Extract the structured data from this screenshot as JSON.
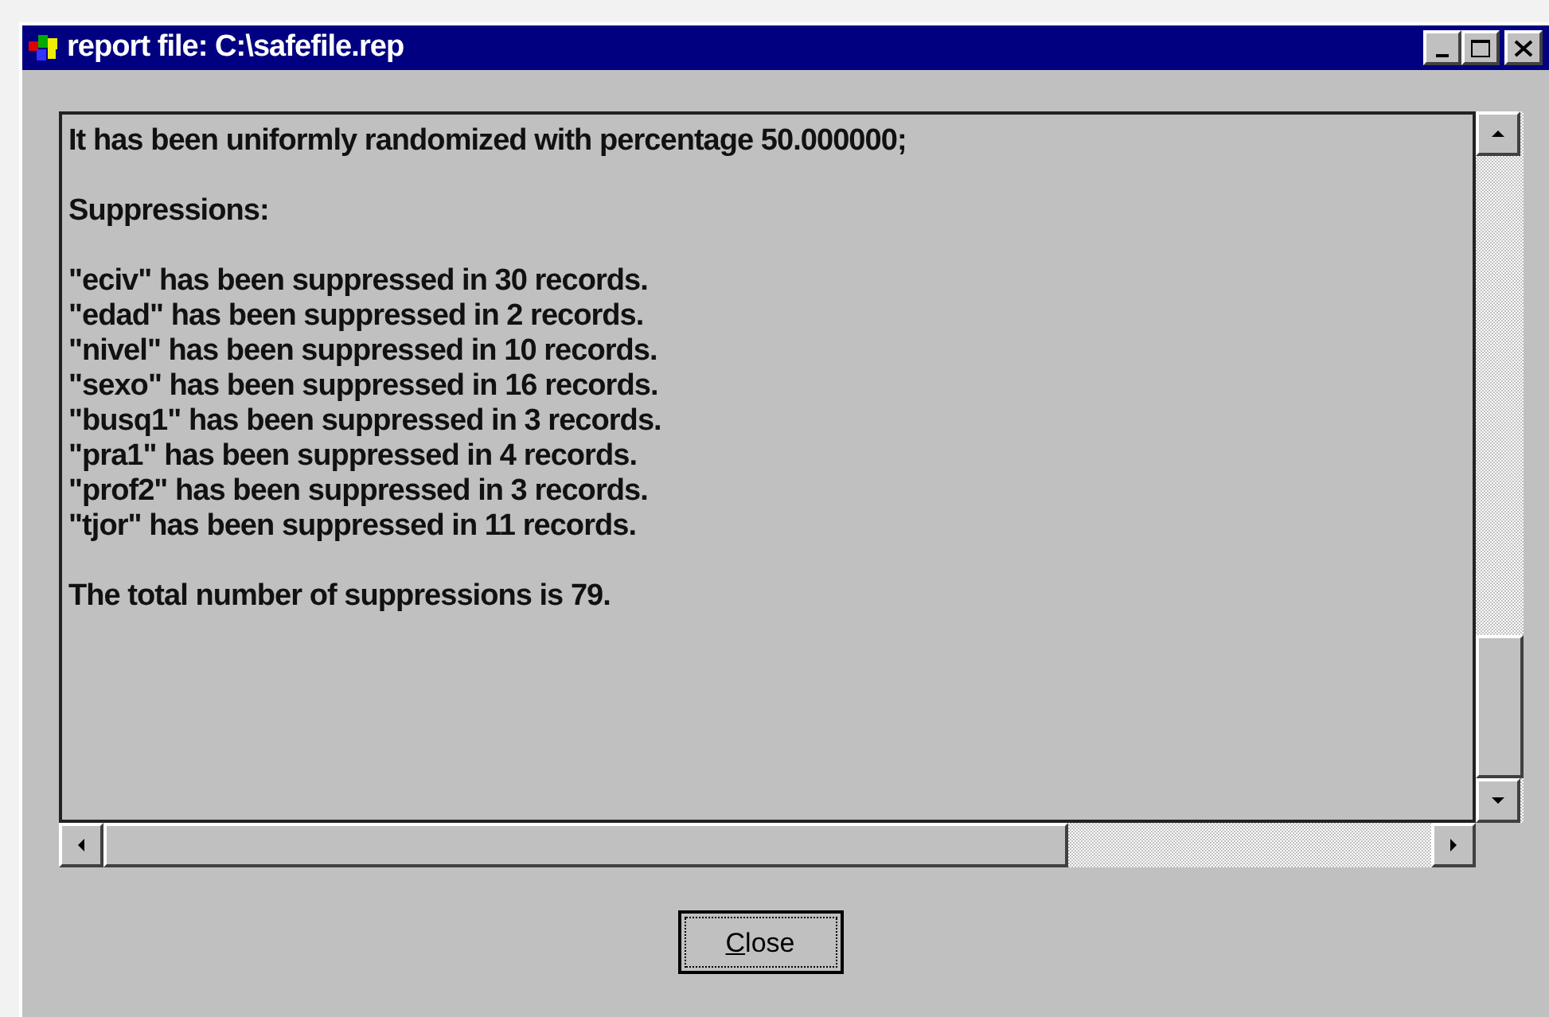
{
  "window": {
    "title": "report file: C:\\safefile.rep"
  },
  "report": {
    "paragraphs": [
      [
        "It has been uniformly randomized with percentage 50.000000;"
      ],
      [
        "Suppressions:"
      ],
      [
        "\"eciv\" has been suppressed in 30 records.",
        "\"edad\" has been suppressed in 2 records.",
        "\"nivel\" has been suppressed in 10 records.",
        "\"sexo\" has been suppressed in 16 records.",
        "\"busq1\" has been suppressed in 3 records.",
        "\"pra1\" has been suppressed in 4 records.",
        "\"prof2\" has been suppressed in 3 records.",
        "\"tjor\" has been suppressed in 11 records."
      ],
      [
        "The total number of suppressions is 79."
      ]
    ]
  },
  "buttons": [
    {
      "label": "Close"
    }
  ]
}
